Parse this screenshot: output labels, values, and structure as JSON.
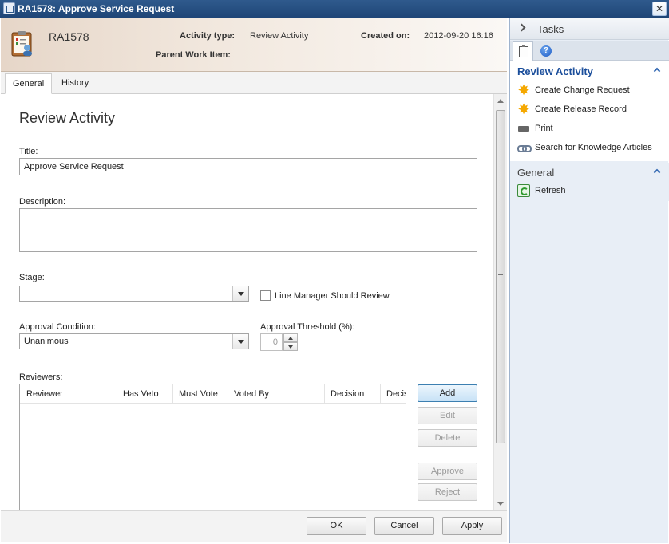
{
  "window": {
    "title": "RA1578: Approve Service Request"
  },
  "header": {
    "id": "RA1578",
    "activity_type_label": "Activity type:",
    "activity_type_value": "Review Activity",
    "created_on_label": "Created on:",
    "created_on_value": "2012-09-20 16:16",
    "parent_label": "Parent Work Item:"
  },
  "tabs": [
    {
      "label": "General",
      "active": true
    },
    {
      "label": "History",
      "active": false
    }
  ],
  "form": {
    "section_title": "Review Activity",
    "title_label": "Title:",
    "title_value": "Approve Service Request",
    "description_label": "Description:",
    "description_value": "",
    "stage_label": "Stage:",
    "stage_value": "",
    "line_manager_label": "Line Manager Should Review",
    "line_manager_checked": false,
    "approval_condition_label": "Approval Condition:",
    "approval_condition_value": "Unanimous",
    "approval_threshold_label": "Approval Threshold (%):",
    "approval_threshold_value": "0",
    "reviewers_label": "Reviewers:",
    "reviewer_columns": [
      "Reviewer",
      "Has Veto",
      "Must Vote",
      "Voted By",
      "Decision",
      "Decision Date"
    ],
    "reviewer_buttons": {
      "add": "Add",
      "edit": "Edit",
      "delete": "Delete",
      "approve": "Approve",
      "reject": "Reject"
    }
  },
  "footer": {
    "ok": "OK",
    "cancel": "Cancel",
    "apply": "Apply"
  },
  "tasks": {
    "title": "Tasks",
    "review_group_title": "Review Activity",
    "review_items": [
      {
        "label": "Create Change Request",
        "icon": "star-icon"
      },
      {
        "label": "Create Release Record",
        "icon": "star-icon"
      },
      {
        "label": "Print",
        "icon": "printer-icon"
      },
      {
        "label": "Search for Knowledge Articles",
        "icon": "link-icon"
      }
    ],
    "general_group_title": "General",
    "general_items": [
      {
        "label": "Refresh",
        "icon": "refresh-icon"
      }
    ]
  }
}
